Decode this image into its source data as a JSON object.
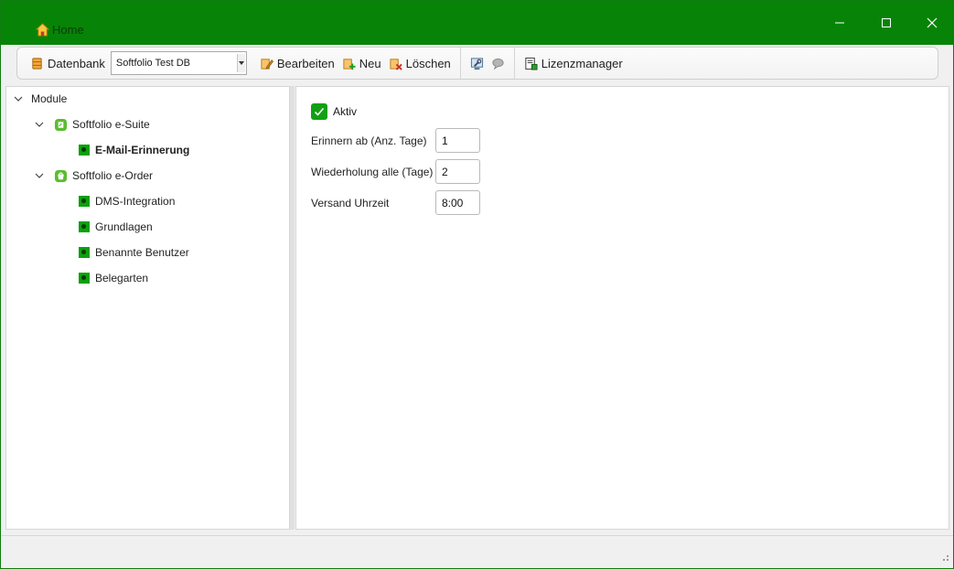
{
  "window": {
    "title": "Home",
    "accent_color": "#078407"
  },
  "toolbar": {
    "database_label": "Datenbank",
    "database_selected": "Softfolio Test DB",
    "edit_label": "Bearbeiten",
    "new_label": "Neu",
    "delete_label": "Löschen",
    "license_label": "Lizenzmanager"
  },
  "tree": {
    "root": "Module",
    "groups": [
      {
        "label": "Softfolio e-Suite",
        "icon": "module-icon",
        "items": [
          "E-Mail-Erinnerung"
        ]
      },
      {
        "label": "Softfolio e-Order",
        "icon": "module-icon",
        "items": [
          "DMS-Integration",
          "Grundlagen",
          "Benannte Benutzer",
          "Belegarten"
        ]
      }
    ],
    "selected": "E-Mail-Erinnerung"
  },
  "form": {
    "active_label": "Aktiv",
    "active_checked": true,
    "fields": [
      {
        "label": "Erinnern ab (Anz. Tage)",
        "value": "1"
      },
      {
        "label": "Wiederholung alle (Tage)",
        "value": "2"
      },
      {
        "label": "Versand Uhrzeit",
        "value": "8:00"
      }
    ]
  }
}
